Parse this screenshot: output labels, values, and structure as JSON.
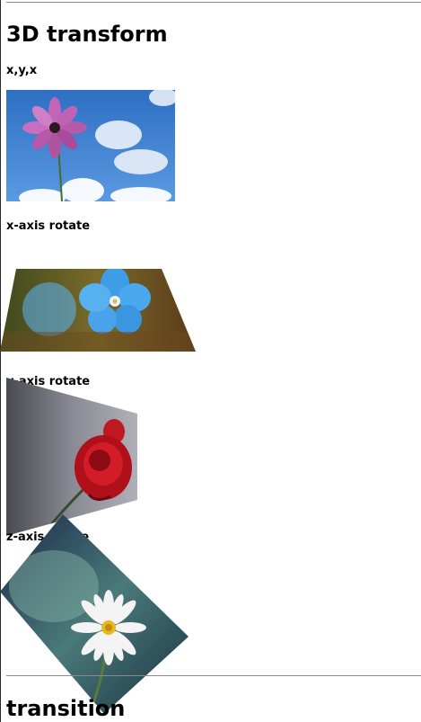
{
  "sections": {
    "transform_title": "3D transform",
    "transition_title": "transition"
  },
  "examples": [
    {
      "label": "x,y,x",
      "image": "cosmos-flower-photo"
    },
    {
      "label": "x-axis rotate",
      "image": "blue-flower-photo"
    },
    {
      "label": "y-axis rotate",
      "image": "red-rose-photo"
    },
    {
      "label": "z-axis rotate",
      "image": "white-daisy-photo"
    }
  ],
  "colors": {
    "rule": "#8a8a8a",
    "sky": "#3a78c8"
  }
}
